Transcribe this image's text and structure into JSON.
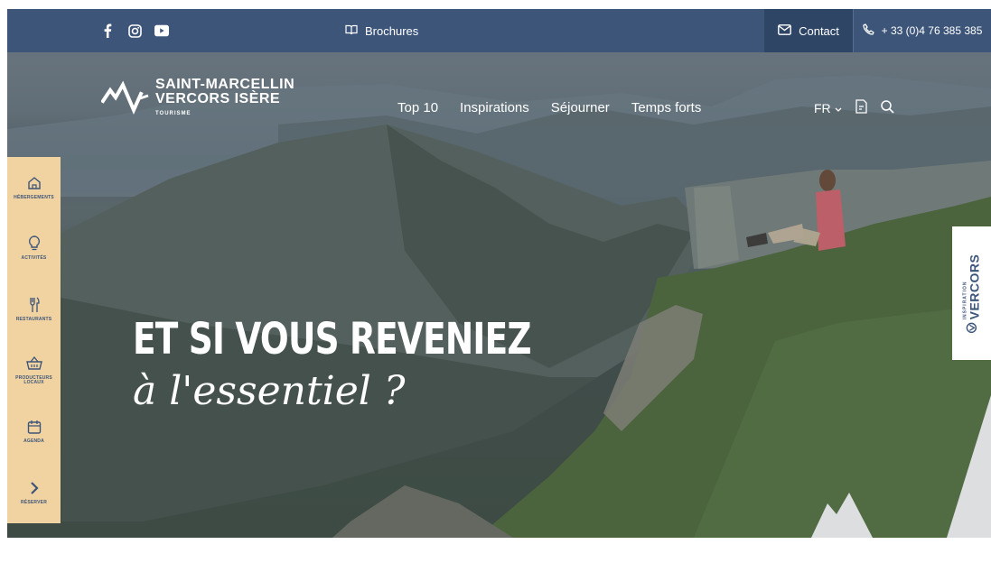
{
  "topbar": {
    "social": [
      "facebook-icon",
      "instagram-icon",
      "youtube-icon"
    ],
    "brochures_label": "Brochures",
    "contact_label": "Contact",
    "phone_label": "+ 33 (0)4 76 385 385"
  },
  "logo": {
    "line1": "SAINT-MARCELLIN",
    "line2": "VERCORS ISÈRE",
    "sub": "TOURISME"
  },
  "nav": {
    "items": [
      "Top 10",
      "Inspirations",
      "Séjourner",
      "Temps forts"
    ],
    "lang": "FR"
  },
  "sidebar": {
    "items": [
      {
        "label": "Hébergements",
        "icon": "home-icon"
      },
      {
        "label": "Activités",
        "icon": "lightbulb-icon"
      },
      {
        "label": "Restaurants",
        "icon": "cutlery-icon"
      },
      {
        "label": "Producteurs locaux",
        "icon": "basket-icon"
      },
      {
        "label": "Agenda",
        "icon": "calendar-icon"
      },
      {
        "label": "Réserver",
        "icon": "chevron-right-icon"
      }
    ]
  },
  "hero": {
    "headline_line1": "ET SI VOUS REVENIEZ",
    "headline_line2": "à l'essentiel ?"
  },
  "badge": {
    "small": "INSPIRATION",
    "label": "VERCORS"
  },
  "colors": {
    "primary": "#3d5579",
    "sidebar": "#f1d3a1"
  }
}
